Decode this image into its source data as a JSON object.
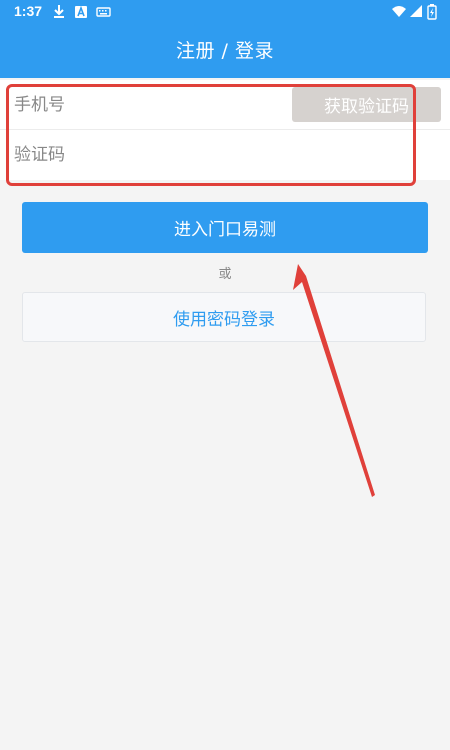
{
  "status_bar": {
    "time": "1:37",
    "icons": [
      "download-icon",
      "a-badge-icon",
      "keyboard-icon",
      "wifi-icon",
      "signal-icon",
      "battery-icon"
    ]
  },
  "header": {
    "title": "注册 / 登录"
  },
  "form": {
    "phone_placeholder": "手机号",
    "code_placeholder": "验证码",
    "get_code_label": "获取验证码"
  },
  "actions": {
    "enter_label": "进入门口易测",
    "or_label": "或",
    "password_login_label": "使用密码登录"
  },
  "colors": {
    "accent": "#2f9cf0",
    "background": "#f4f4f4",
    "get_code_disabled": "#d6d2cf",
    "annotation_red": "#e0403a"
  }
}
